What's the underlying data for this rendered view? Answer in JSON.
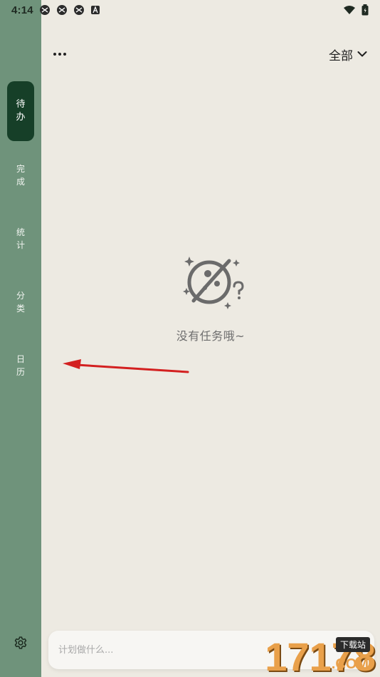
{
  "status_bar": {
    "time": "4:14",
    "left_icons": [
      "app-icon",
      "app-icon",
      "app-icon",
      "a-icon"
    ],
    "right_icons": [
      "wifi-icon",
      "battery-icon"
    ]
  },
  "sidebar": {
    "items": [
      {
        "id": "todo",
        "label_lines": [
          "待",
          "办"
        ],
        "active": true
      },
      {
        "id": "done",
        "label_lines": [
          "完",
          "成"
        ],
        "active": false
      },
      {
        "id": "stats",
        "label_lines": [
          "统",
          "计"
        ],
        "active": false
      },
      {
        "id": "category",
        "label_lines": [
          "分",
          "类"
        ],
        "active": false
      },
      {
        "id": "calendar",
        "label_lines": [
          "日",
          "历"
        ],
        "active": false
      }
    ],
    "settings_icon": "gear-icon"
  },
  "header": {
    "more_icon": "more-icon",
    "filter_label": "全部",
    "filter_icon": "chevron-down-icon"
  },
  "empty_state": {
    "illustration": "planet-question-icon",
    "message": "没有任务哦~"
  },
  "composer": {
    "placeholder": "计划做什么..."
  },
  "colors": {
    "sidebar": "#6f937b",
    "active": "#163f28",
    "background": "#edeae2",
    "arrow": "#d32020"
  },
  "watermark": {
    "digits": "17178",
    "badge": "下载站",
    "com": ".COM"
  }
}
